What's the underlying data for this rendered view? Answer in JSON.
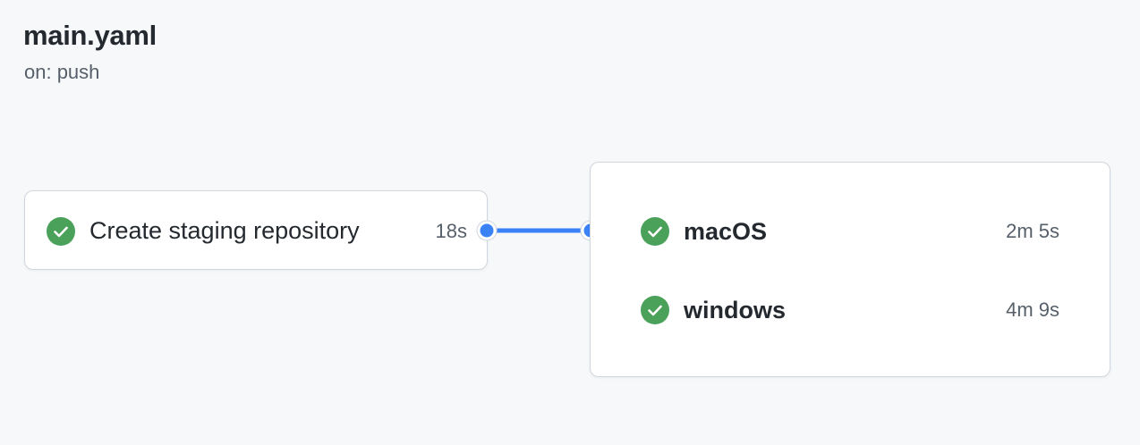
{
  "workflow": {
    "title": "main.yaml",
    "trigger": "on: push"
  },
  "jobs": {
    "staging": {
      "name": "Create staging repository",
      "duration": "18s",
      "status": "success"
    },
    "matrix": [
      {
        "name": "macOS",
        "duration": "2m 5s",
        "status": "success"
      },
      {
        "name": "windows",
        "duration": "4m 9s",
        "status": "success"
      }
    ]
  },
  "colors": {
    "success": "#4aa15a",
    "connector": "#3b82f6",
    "background": "#f6f8fa"
  },
  "icons": {
    "status": "check-circle-icon",
    "connector_node": "connector-dot"
  }
}
